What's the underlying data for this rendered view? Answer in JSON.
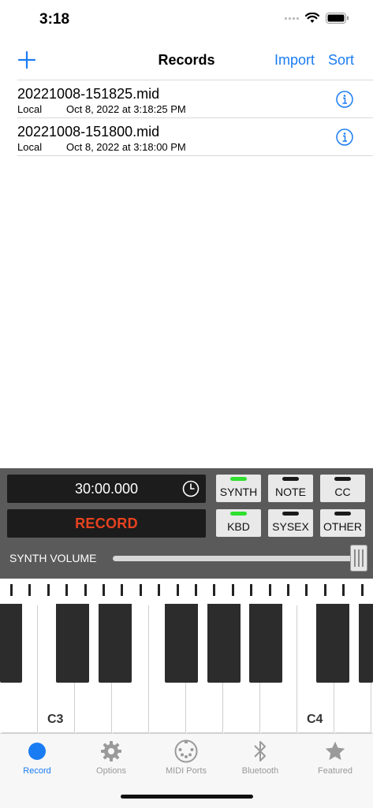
{
  "status": {
    "time": "3:18"
  },
  "nav": {
    "add_icon": "plus-icon",
    "title": "Records",
    "import_label": "Import",
    "sort_label": "Sort"
  },
  "records": [
    {
      "name": "20221008-151825.mid",
      "source": "Local",
      "date": "Oct 8, 2022 at 3:18:25 PM"
    },
    {
      "name": "20221008-151800.mid",
      "source": "Local",
      "date": "Oct 8, 2022 at 3:18:00 PM"
    }
  ],
  "controls": {
    "timer": "30:00.000",
    "record_label": "RECORD",
    "buttons": [
      {
        "label": "SYNTH",
        "led": "on"
      },
      {
        "label": "NOTE",
        "led": "off"
      },
      {
        "label": "CC",
        "led": "off"
      },
      {
        "label": "KBD",
        "led": "on"
      },
      {
        "label": "SYSEX",
        "led": "off"
      },
      {
        "label": "OTHER",
        "led": "off"
      }
    ],
    "volume_label": "SYNTH VOLUME",
    "volume_level": 1.0
  },
  "keyboard": {
    "labels": [
      "C3",
      "C4"
    ]
  },
  "tabs": [
    {
      "label": "Record",
      "icon": "record-dot-icon",
      "active": true
    },
    {
      "label": "Options",
      "icon": "gear-icon",
      "active": false
    },
    {
      "label": "MIDI Ports",
      "icon": "midi-port-icon",
      "active": false
    },
    {
      "label": "Bluetooth",
      "icon": "bluetooth-icon",
      "active": false
    },
    {
      "label": "Featured",
      "icon": "star-icon",
      "active": false
    }
  ],
  "colors": {
    "accent": "#1a7cf3",
    "record_text": "#e6421f",
    "led_on": "#2fe02f",
    "panel": "#5a5a5a"
  }
}
